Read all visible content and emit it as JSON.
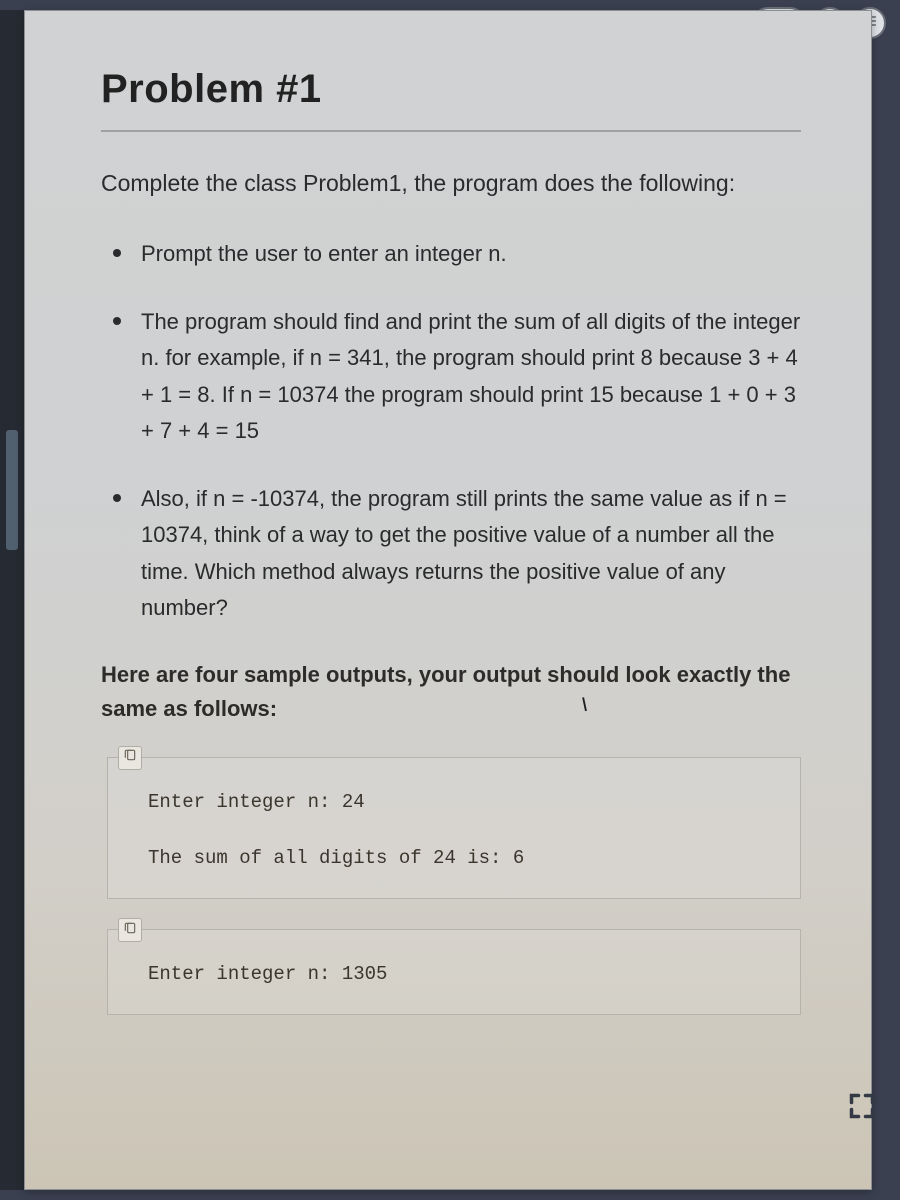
{
  "title": "Problem #1",
  "intro": "Complete the class Problem1, the program does the following:",
  "bullets": [
    "Prompt the user to enter an integer n.",
    "The program should find and print the sum of all digits of the integer n.\nfor example, if n = 341, the program should print 8 because 3 + 4 + 1 = 8.\nIf n = 10374 the program should print 15 because 1 + 0 + 3 + 7 + 4 = 15",
    "Also, if n = -10374, the program still prints the same value as if n = 10374, think of a way to get the positive value of a number all the time. Which method always returns the positive value of any number?"
  ],
  "outputs_intro": "Here are four sample outputs, your output should look exactly the same as follows:",
  "samples": [
    {
      "line1": "Enter integer n: 24",
      "line2": "The sum of all digits of 24 is: 6"
    },
    {
      "line1": "Enter integer n: 1305",
      "line2": ""
    }
  ]
}
